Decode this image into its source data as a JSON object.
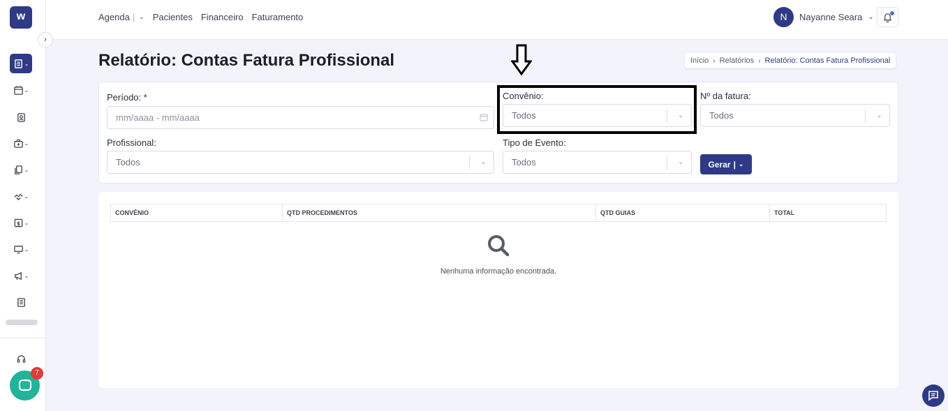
{
  "logo": {
    "letter": "w"
  },
  "topnav": {
    "items": [
      {
        "label": "Agenda"
      },
      {
        "label": "Pacientes"
      },
      {
        "label": "Financeiro"
      },
      {
        "label": "Faturamento"
      }
    ],
    "separator": "|"
  },
  "user": {
    "initial": "N",
    "name": "Nayanne Seara"
  },
  "page": {
    "title": "Relatório: Contas Fatura Profissional"
  },
  "breadcrumb": [
    "Início",
    "Relatórios",
    "Relatório: Contas Fatura Profissional"
  ],
  "filters": {
    "periodo": {
      "label": "Período: *",
      "placeholder": "mm/aaaa - mm/aaaa"
    },
    "convenio": {
      "label": "Convênio:",
      "value": "Todos"
    },
    "fatura": {
      "label": "Nº da fatura:",
      "value": "Todos"
    },
    "profissional": {
      "label": "Profissional:",
      "value": "Todos"
    },
    "evento": {
      "label": "Tipo de Evento:",
      "value": "Todos"
    },
    "gerar_label": "Gerar"
  },
  "table": {
    "columns": [
      "CONVÊNIO",
      "QTD PROCEDIMENTOS",
      "QTD GUIAS",
      "TOTAL"
    ],
    "empty_text": "Nenhuma informação encontrada."
  },
  "chat": {
    "badge": "7"
  },
  "colors": {
    "primary": "#2e3a87",
    "chat": "#20b49a",
    "badge": "#e53935"
  }
}
